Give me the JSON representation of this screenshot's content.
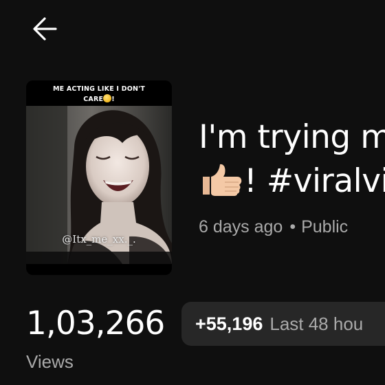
{
  "header": {
    "back_icon": "arrow-left-icon"
  },
  "video": {
    "thumbnail": {
      "caption_line1": "ME ACTING LIKE I DON'T",
      "caption_line2": "CARE",
      "caption_suffix": "!",
      "caption_emoji": "slightly-smiling-face-emoji",
      "watermark_handle": "@Itx_me_xx._."
    },
    "title_line1": "I'm trying m",
    "title_emoji": "thumbs-up-icon",
    "title_line2": "! #viralvi",
    "age": "6 days ago",
    "separator": "•",
    "visibility": "Public"
  },
  "stats": {
    "views_count": "1,03,266",
    "views_label": "Views",
    "delta_value": "+55,196",
    "delta_label": "Last 48 hou"
  },
  "colors": {
    "background": "#0f0f0f",
    "text_primary": "#ffffff",
    "text_secondary": "#aaaaaa",
    "pill_background": "#272727",
    "thumbs_up": "#f4c9a6"
  }
}
